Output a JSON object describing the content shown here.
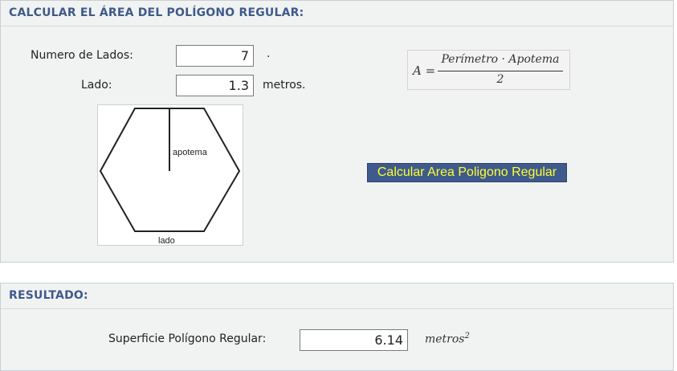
{
  "calc_section": {
    "title": "CALCULAR EL ÁREA DEL POLÍGONO REGULAR:",
    "sides_label": "Numero de Lados:",
    "sides_value": "7",
    "sides_suffix": ".",
    "side_label": "Lado:",
    "side_value": "1.3",
    "side_unit": "metros.",
    "diagram": {
      "apotema_label": "apotema",
      "lado_label": "lado"
    },
    "formula": {
      "lhs": "A =",
      "numerator": "Perímetro · Apotema",
      "denominator": "2"
    },
    "calculate_button": "Calcular Area Poligono Regular"
  },
  "result_section": {
    "title": "RESULTADO:",
    "surface_label": "Superficie Polígono Regular:",
    "surface_value": "6.14",
    "unit": "metros",
    "unit_exponent": "2"
  },
  "colors": {
    "header_text": "#3f5a8c",
    "button_bg": "#3f5a8c",
    "button_text": "#ffff33"
  }
}
